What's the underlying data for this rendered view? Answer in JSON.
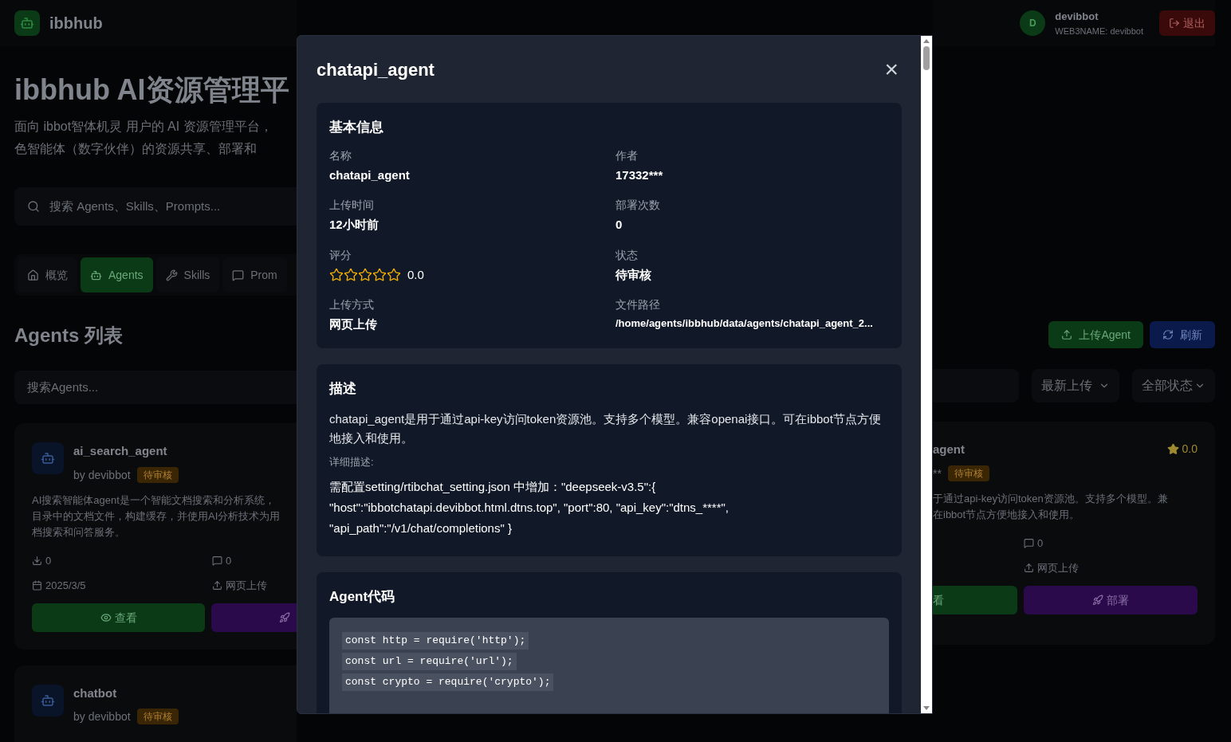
{
  "header": {
    "brand": "ibbhub",
    "user": {
      "avatar": "D",
      "name": "devibbot",
      "web3name": "WEB3NAME: devibbot"
    },
    "logout": "退出"
  },
  "hero": {
    "title": "ibbhub AI资源管理平",
    "subtitle_lines": [
      "面向 ibbot智体机灵 用户的 AI 资源管理平台，",
      "色智能体（数字伙伴）的资源共享、部署和"
    ]
  },
  "search": {
    "placeholder": "搜索 Agents、Skills、Prompts..."
  },
  "tabs": [
    {
      "label": "概览",
      "selected": false
    },
    {
      "label": "Agents",
      "selected": true
    },
    {
      "label": "Skills",
      "selected": false
    },
    {
      "label": "Prom",
      "selected": false
    }
  ],
  "section": {
    "title": "Agents 列表",
    "upload": "上传Agent",
    "refresh": "刷新",
    "filter_placeholder": "搜索Agents...",
    "sort": "最新上传",
    "status_filter": "全部状态"
  },
  "cards_left": [
    {
      "title": "ai_search_agent",
      "author": "by devibbot",
      "status": "待审核",
      "description_lines": [
        "AI搜索智能体agent是一个智能文档搜索和分析系统，",
        "目录中的文档文件，构建缓存，并使用AI分析技术为用",
        "档搜索和问答服务。"
      ],
      "downloads": "0",
      "comments": "0",
      "date": "2025/3/5",
      "upload": "网页上传",
      "view": "查看"
    },
    {
      "title": "chatbot",
      "author": "by devibbot",
      "status": "待审核"
    }
  ],
  "card_right": {
    "title": "agent",
    "author": "**",
    "status": "待审核",
    "rating": "0.0",
    "description_lines": [
      "于通过api-key访问token资源池。支持多个模型。兼",
      "在ibbot节点方便地接入和使用。"
    ],
    "comments": "0",
    "upload": "网页上传",
    "view": "看",
    "deploy": "部署"
  },
  "modal": {
    "title": "chatapi_agent",
    "close": "×",
    "info": {
      "heading": "基本信息",
      "fields": [
        {
          "kind": "text",
          "label": "名称",
          "value": "chatapi_agent"
        },
        {
          "kind": "text",
          "label": "作者",
          "value": "17332***"
        },
        {
          "kind": "text",
          "label": "上传时间",
          "value": "12小时前"
        },
        {
          "kind": "text",
          "label": "部署次数",
          "value": "0"
        },
        {
          "kind": "rating",
          "label": "评分",
          "stars": 0,
          "value": "0.0"
        },
        {
          "kind": "text",
          "label": "状态",
          "value": "待审核"
        },
        {
          "kind": "text",
          "label": "上传方式",
          "value": "网页上传"
        },
        {
          "kind": "path",
          "label": "文件路径",
          "value": "/home/agents/ibbhub/data/agents/chatapi_agent_2..."
        }
      ]
    },
    "description": {
      "heading": "描述",
      "text": "chatapi_agent是用于通过api-key访问token资源池。支持多个模型。兼容openai接口。可在ibbot节点方便地接入和使用。",
      "detail_label": "详细描述:",
      "detail": "需配置setting/rtibchat_setting.json 中增加：\"deepseek-v3.5\":{ \"host\":\"ibbotchatapi.devibbot.html.dtns.top\", \"port\":80, \"api_key\":\"dtns_****\", \"api_path\":\"/v1/chat/completions\" }"
    },
    "code": {
      "heading": "Agent代码",
      "lines": [
        "const http = require('http');",
        "const url = require('url');",
        "const crypto = require('crypto');"
      ]
    }
  }
}
